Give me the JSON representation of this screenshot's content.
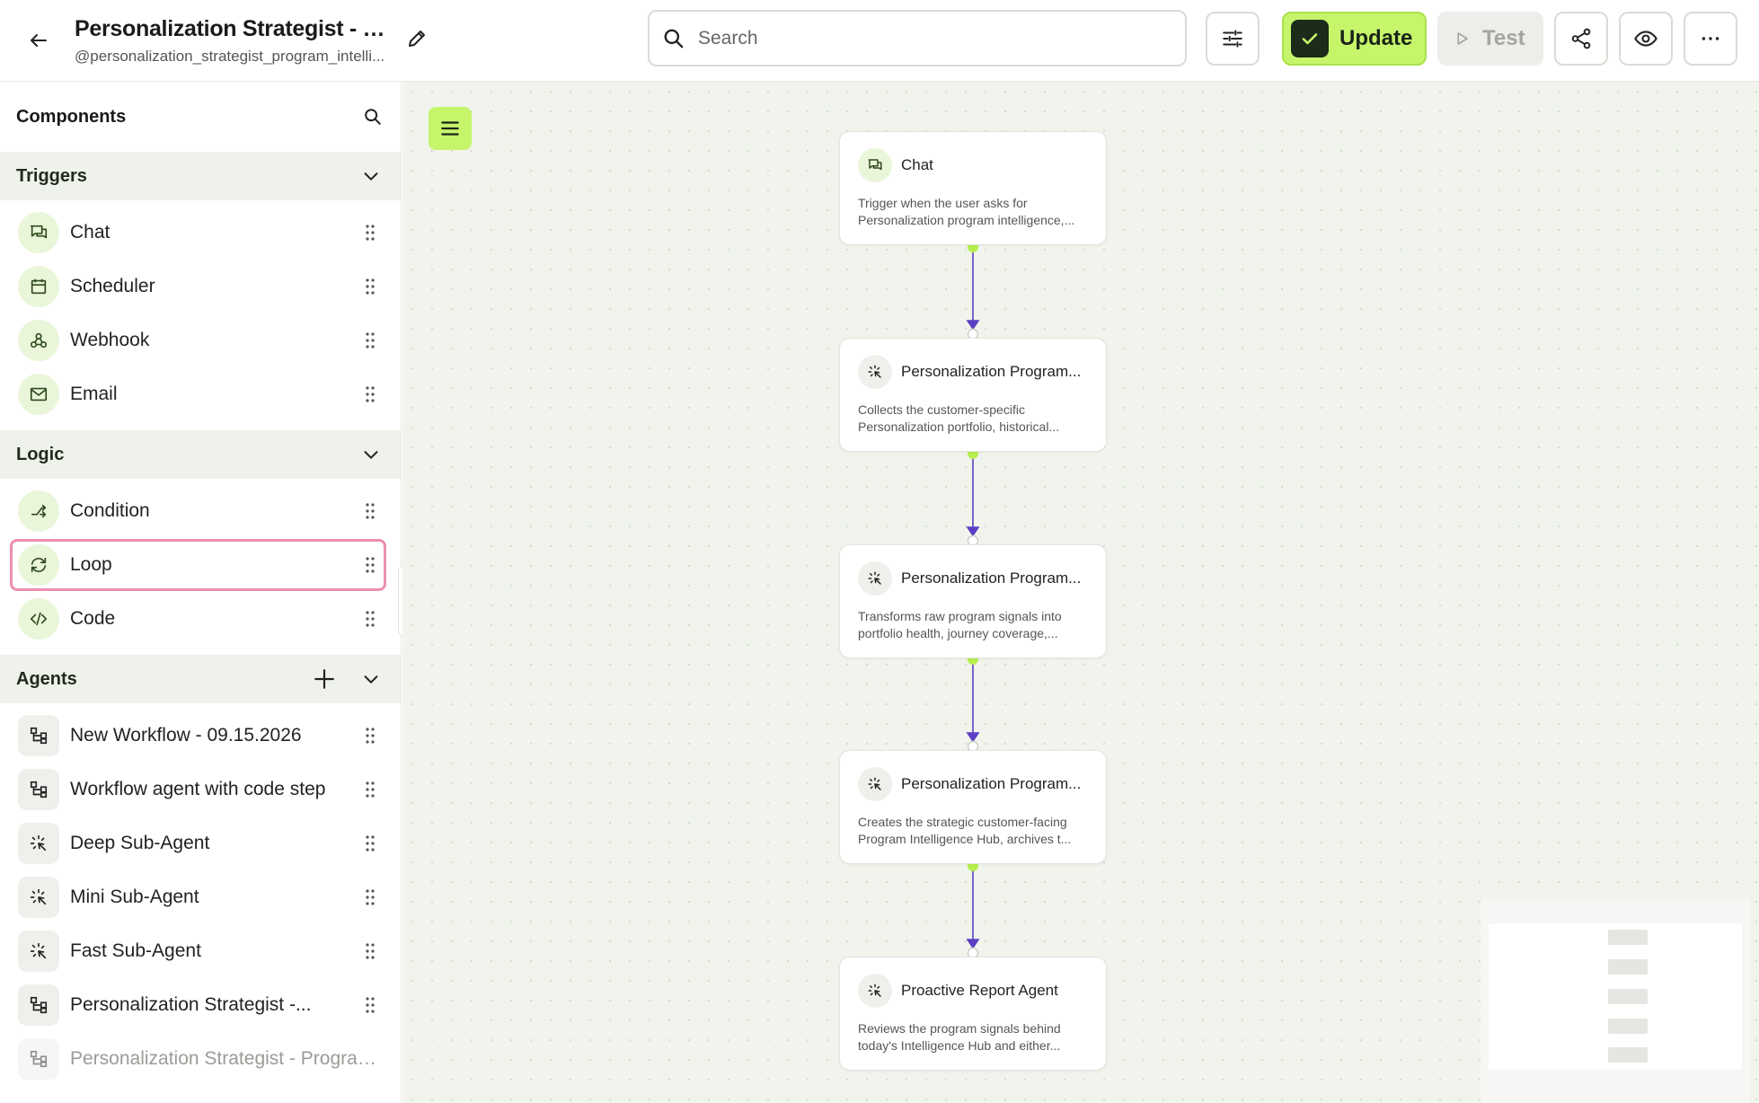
{
  "header": {
    "title": "Personalization Strategist - Pro...",
    "handle": "@personalization_strategist_program_intelli...",
    "search_placeholder": "Search",
    "update_label": "Update",
    "test_label": "Test"
  },
  "sidebar": {
    "title": "Components",
    "sections": [
      {
        "title": "Triggers",
        "items": [
          {
            "label": "Chat",
            "icon": "chat-icon"
          },
          {
            "label": "Scheduler",
            "icon": "calendar-icon"
          },
          {
            "label": "Webhook",
            "icon": "webhook-icon"
          },
          {
            "label": "Email",
            "icon": "mail-icon"
          }
        ]
      },
      {
        "title": "Logic",
        "items": [
          {
            "label": "Condition",
            "icon": "branch-icon"
          },
          {
            "label": "Loop",
            "icon": "loop-icon"
          },
          {
            "label": "Code",
            "icon": "code-icon"
          }
        ]
      },
      {
        "title": "Agents",
        "items": [
          {
            "label": "New Workflow - 09.15.2026",
            "icon": "workflow-icon"
          },
          {
            "label": "Workflow agent with code step",
            "icon": "workflow-icon"
          },
          {
            "label": "Deep Sub-Agent",
            "icon": "sparkle-icon"
          },
          {
            "label": "Mini Sub-Agent",
            "icon": "sparkle-icon"
          },
          {
            "label": "Fast Sub-Agent",
            "icon": "sparkle-icon"
          },
          {
            "label": "Personalization Strategist -...",
            "icon": "workflow-icon"
          },
          {
            "label": "Personalization Strategist - Program...",
            "icon": "workflow-icon"
          }
        ]
      }
    ]
  },
  "canvas": {
    "nodes": [
      {
        "title": "Chat",
        "description": "Trigger when the user asks for Personalization program intelligence,...",
        "icon": "chat-icon"
      },
      {
        "title": "Personalization Program...",
        "description": "Collects the customer-specific Personalization portfolio, historical...",
        "icon": "sparkle-icon"
      },
      {
        "title": "Personalization Program...",
        "description": "Transforms raw program signals into portfolio health, journey coverage,...",
        "icon": "sparkle-icon"
      },
      {
        "title": "Personalization Program...",
        "description": "Creates the strategic customer-facing Program Intelligence Hub, archives t...",
        "icon": "sparkle-icon"
      },
      {
        "title": "Proactive Report Agent",
        "description": "Reviews the program signals behind today's Intelligence Hub and either...",
        "icon": "sparkle-icon"
      }
    ]
  },
  "colors": {
    "accent": "#c6f56b",
    "edge": "#5b3fc4",
    "highlight": "#ec8fb0"
  }
}
